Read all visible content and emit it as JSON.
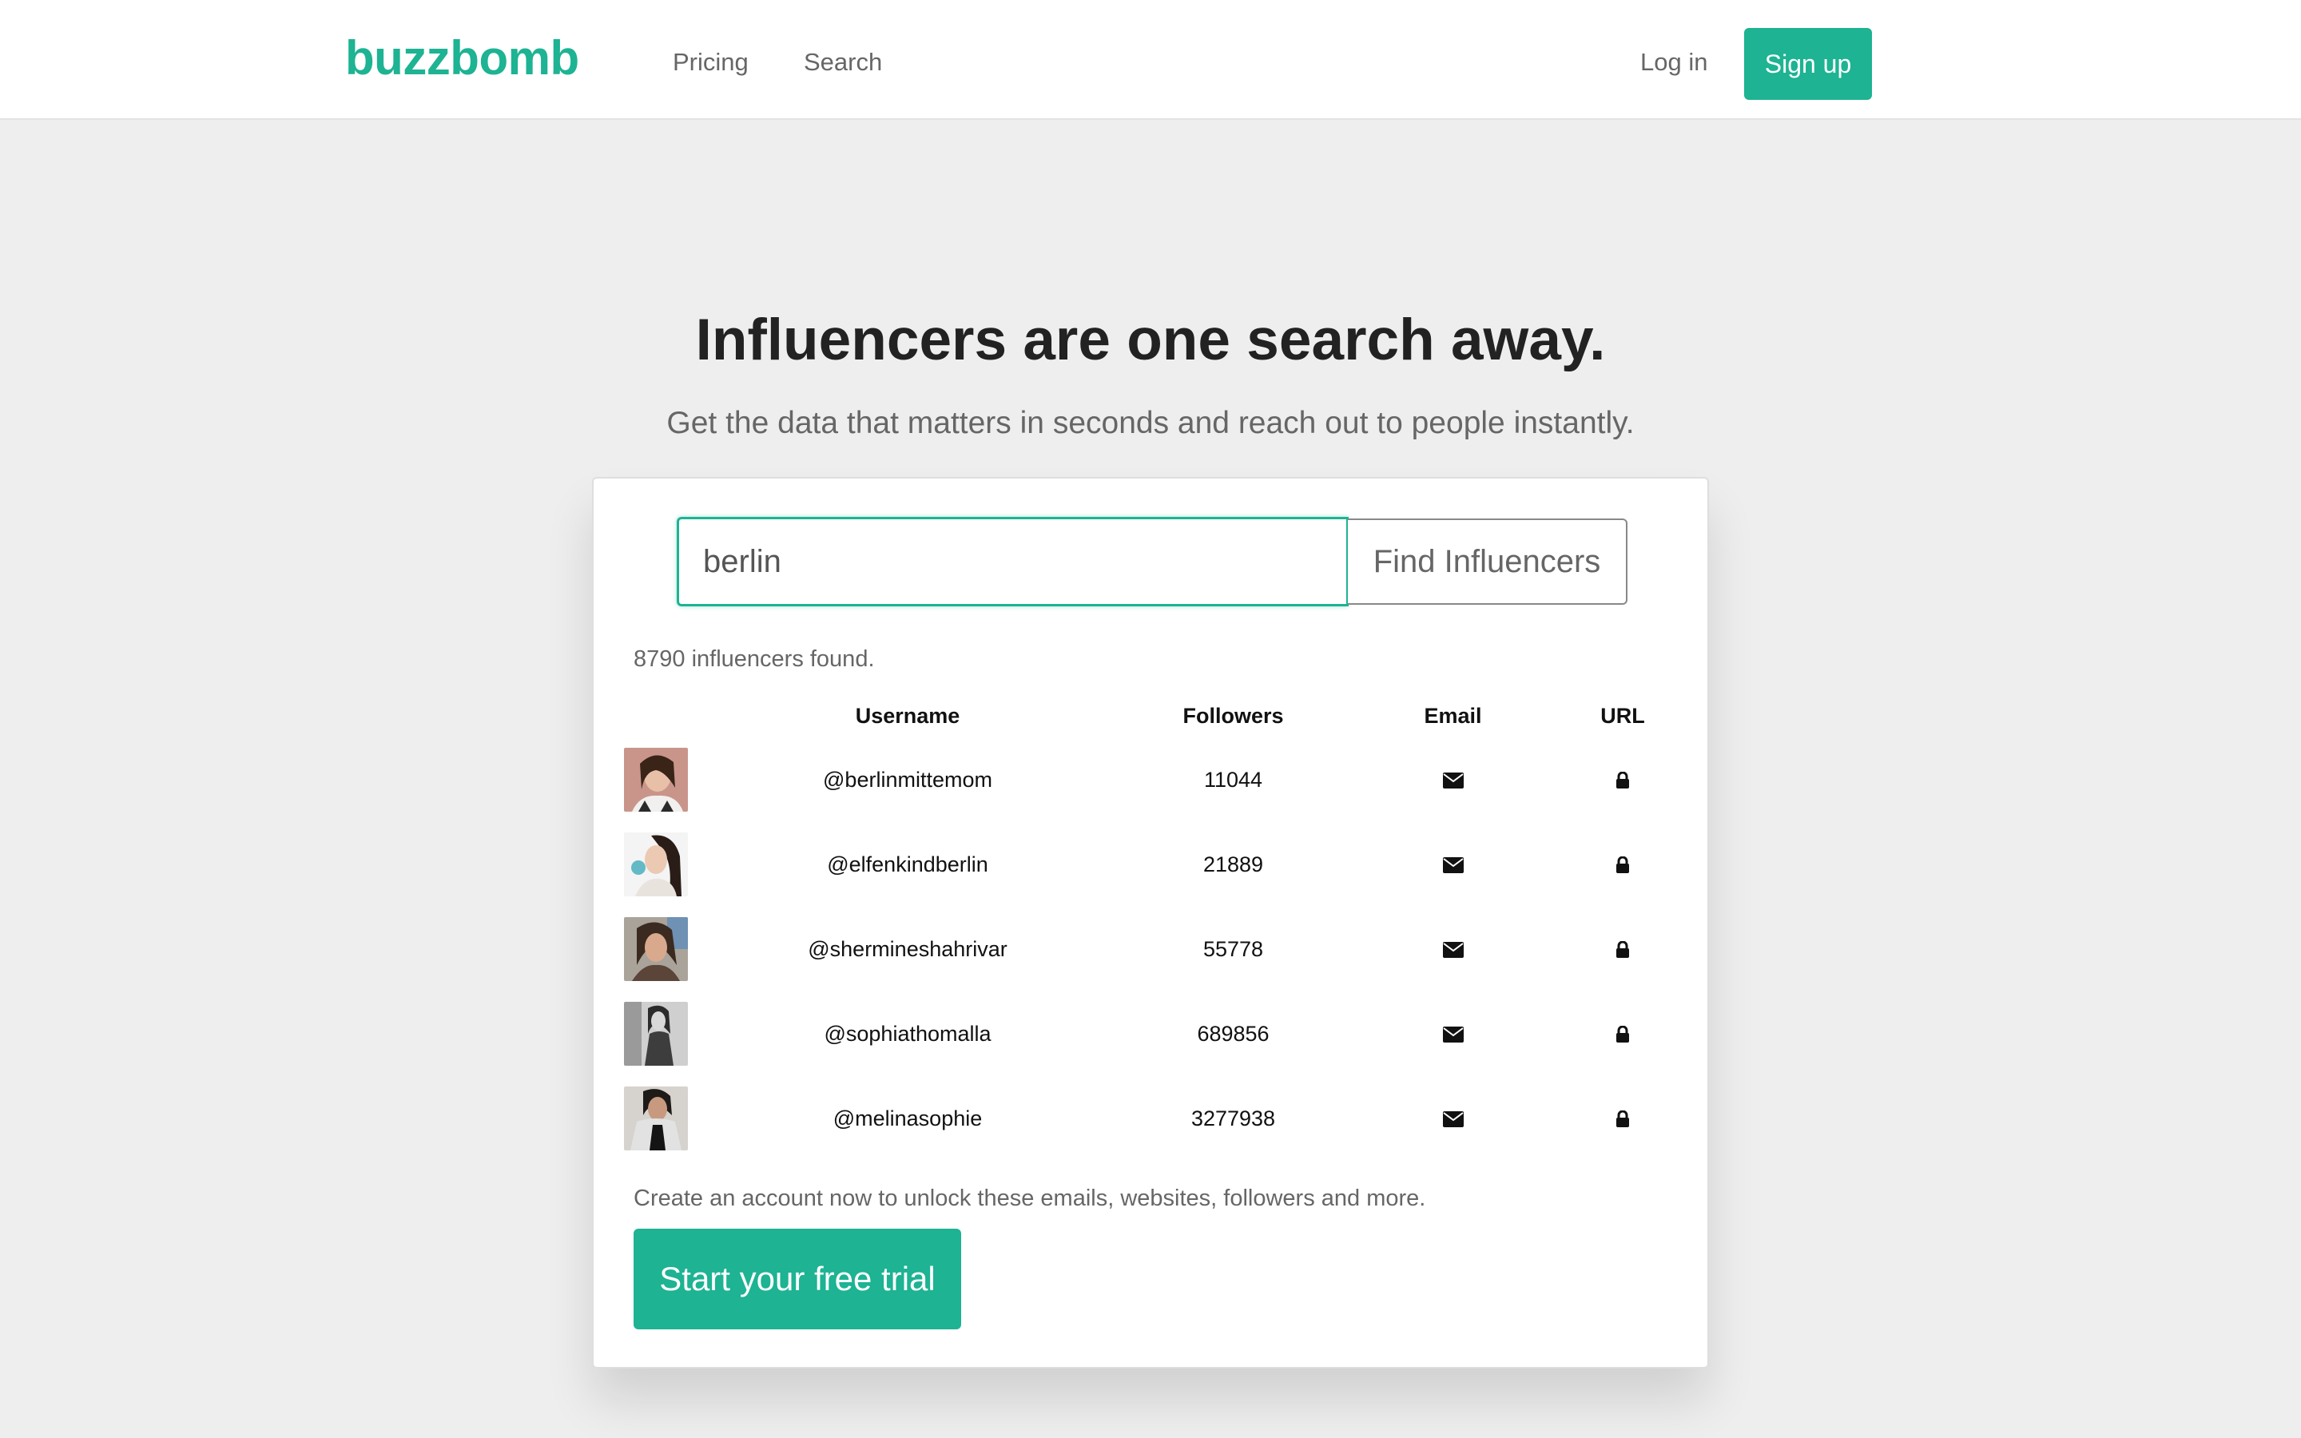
{
  "header": {
    "brand": "buzzbomb",
    "nav": {
      "pricing": "Pricing",
      "search": "Search"
    },
    "login": "Log in",
    "signup": "Sign up"
  },
  "hero": {
    "title": "Influencers are one search away.",
    "subtitle": "Get the data that matters in seconds and reach out to people instantly."
  },
  "search": {
    "value": "berlin",
    "button": "Find Influencers"
  },
  "results": {
    "count_text": "8790 influencers found.",
    "headers": {
      "username": "Username",
      "followers": "Followers",
      "email": "Email",
      "url": "URL"
    },
    "rows": [
      {
        "username": "@berlinmittemom",
        "followers": "11044",
        "email_icon": "envelope-icon",
        "url_icon": "lock-icon"
      },
      {
        "username": "@elfenkindberlin",
        "followers": "21889",
        "email_icon": "envelope-icon",
        "url_icon": "lock-icon"
      },
      {
        "username": "@shermineshahrivar",
        "followers": "55778",
        "email_icon": "envelope-icon",
        "url_icon": "lock-icon"
      },
      {
        "username": "@sophiathomalla",
        "followers": "689856",
        "email_icon": "envelope-icon",
        "url_icon": "lock-icon"
      },
      {
        "username": "@melinasophie",
        "followers": "3277938",
        "email_icon": "envelope-icon",
        "url_icon": "lock-icon"
      }
    ]
  },
  "cta": {
    "text": "Create an account now to unlock these emails, websites, followers and more.",
    "button": "Start your free trial"
  },
  "colors": {
    "accent": "#1db393",
    "background": "#eeeeee",
    "card": "#ffffff",
    "muted_text": "#666666"
  }
}
